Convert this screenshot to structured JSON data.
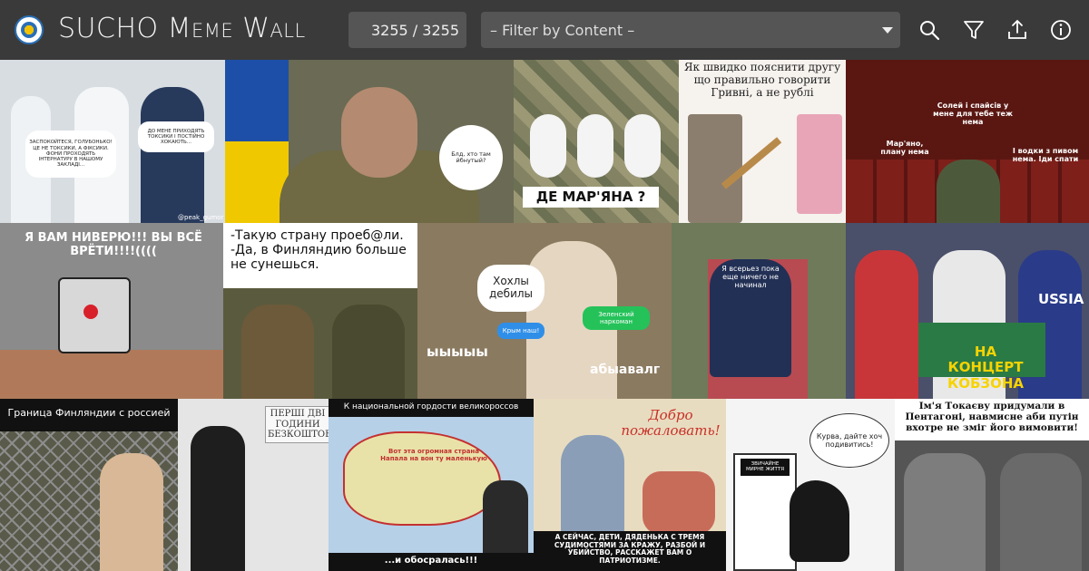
{
  "header": {
    "title": "SUCHO Meme Wall",
    "counter": "3255 / 3255",
    "filter_placeholder": "– Filter by Content –"
  },
  "icons": {
    "search": "search-icon",
    "filter": "filter-icon",
    "upload": "upload-icon",
    "info": "info-icon"
  },
  "colors": {
    "bar": "#3a3a3a",
    "field": "#555555",
    "background": "#2b2b2b"
  },
  "memes": {
    "m1": {
      "bubble_left": "ЗАСПОКОЙТЕСЯ, ГОЛУБОНЬКО! ЦЕ НЕ ТОКСИКИ, А ФІКСИКИ. ФОНИ ПРОХОДЯТЬ ІНТЕРНАТУРУ В НАШОМУ ЗАКЛАДІ...",
      "bubble_right": "ДО МЕНЕ ПРИХОДЯТЬ ТОКСИКИ І ПОСТІЙНО ХОКАЮТЬ...",
      "handle": "@peak_gumor"
    },
    "m2": {
      "bubble": "Блд, хто там йбнутый?"
    },
    "m3": {
      "caption": "ДЕ МАР'ЯНА ?"
    },
    "m4": {
      "caption": "Як швидко пояснити другу що правильно говорити Гривні, а не рублі"
    },
    "m5": {
      "top": "Солей і спайсів у мене для тебе теж нема",
      "left": "Мар'яно, плану нема",
      "right": "І водки з пивом нема. Іди спати"
    },
    "m6": {
      "caption": "Я ВАМ НИВЕРЮ!!! ВЫ ВСЁ ВРЁТИ!!!!(((("
    },
    "m7": {
      "caption": "-Такую страну проеб@ли. -Да, в Финляндию больше не сунешься."
    },
    "m8": {
      "bubble": "Хохлы дебилы",
      "blue_left": "Крым наш!",
      "green_right": "Зеленский наркоман",
      "bottom_left": "ыыыыы",
      "bottom_right": "абыавалг"
    },
    "m9": {
      "caption": "Я всерьез пока еще ничего не начинал"
    },
    "m10": {
      "caption": "НА КОНЦЕРТ КОБЗОНА",
      "shirt": "USSIA"
    },
    "m11": {
      "caption": "Граница Финляндии с россией"
    },
    "m12": {
      "sign": "ПЕРШІ ДВІ ГОДИНИ БЕЗКОШТОВНО"
    },
    "m13": {
      "header": "К национальной гордости великороссов",
      "map_note": "Вот эта огромная страна Напала на вон ту маленькую",
      "footer": "...и обосралась!!!"
    },
    "m14": {
      "poster": "Добро пожаловать!",
      "caption": "А СЕЙЧАС, ДЕТИ, ДЯДЕНЬКА С ТРЕМЯ СУДИМОСТЯМИ ЗА КРАЖУ, РАЗБОЙ И УБИЙСТВО, РАССКАЖЕТ ВАМ О ПАТРИОТИЗМЕ."
    },
    "m15": {
      "bubble": "Курва, дайте хоч подивитись!",
      "door_sign": "ЗВИЧАЙНЕ МИРНЕ ЖИТТЯ"
    },
    "m16": {
      "caption": "Ім'я Токаєву придумали в Пентагоні, навмисне аби путін вхотре не зміг його вимовити!"
    }
  }
}
